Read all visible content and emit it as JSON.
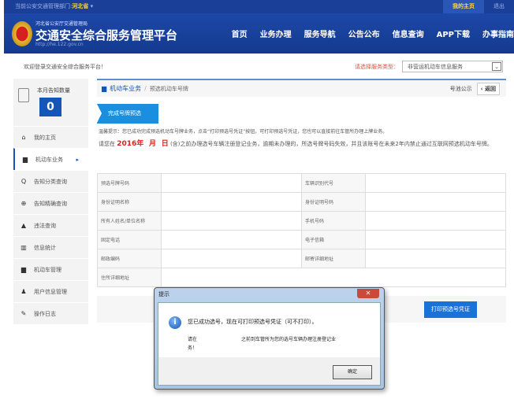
{
  "topbar": {
    "dept_label": "当前公安交通管理部门:",
    "dept": "河北省",
    "home": "我的主页",
    "logout": "退出"
  },
  "header": {
    "sub": "河北省公安厅交通管理局",
    "title": "交通安全综合服务管理平台",
    "url": "http://he.122.gov.cn",
    "nav": [
      "首页",
      "业务办理",
      "服务导航",
      "公告公布",
      "信息查询",
      "APP下载",
      "办事指南"
    ]
  },
  "welcome": "欢迎登录交通安全综合服务平台！",
  "service": {
    "label": "请选择服务类型：",
    "value": "非营运机动车信息服务"
  },
  "sidebar": {
    "count_label": "本月告知数量",
    "count": "0",
    "items": [
      {
        "icon": "home-icon",
        "glyph": "⌂",
        "label": "我的主页"
      },
      {
        "icon": "truck-icon",
        "glyph": "▆",
        "label": "机动车业务"
      },
      {
        "icon": "search-icon",
        "glyph": "Q",
        "label": "告知分类查询"
      },
      {
        "icon": "zoom-icon",
        "glyph": "⊕",
        "label": "告知精确查询"
      },
      {
        "icon": "warning-icon",
        "glyph": "▲",
        "label": "违法查询"
      },
      {
        "icon": "chart-icon",
        "glyph": "▥",
        "label": "信息统计"
      },
      {
        "icon": "car-icon",
        "glyph": "▆",
        "label": "机动车管理"
      },
      {
        "icon": "user-icon",
        "glyph": "♟",
        "label": "用户信息管理"
      },
      {
        "icon": "log-icon",
        "glyph": "✎",
        "label": "操作日志"
      }
    ]
  },
  "breadcrumb": {
    "section": "机动车业务",
    "page": "预选机动车号牌",
    "pool": "号池公示",
    "back": "‹ 返回"
  },
  "step": "完成号牌预选",
  "tip": "温馨提示：您已成功完成预选机动车号牌业务，点击“打印预选号凭证”按钮，可打印预选号凭证，您也可以直接前往车管所办理上牌业务。",
  "warn": {
    "pre": "请您在",
    "year": "2016年",
    "month": "月",
    "day": "日",
    "post": "(含)之前办理选号车辆注册登记业务，逾期未办理的，所选号牌号码失效，并且该账号在未来2年内禁止通过互联网预选机动车号牌。"
  },
  "table": [
    [
      "预选号牌号码",
      "",
      "车辆识别代号",
      ""
    ],
    [
      "身份证明名称",
      "",
      "身份证明号码",
      ""
    ],
    [
      "所有人姓名/单位名称",
      "",
      "手机号码",
      ""
    ],
    [
      "固定电话",
      "",
      "电子信箱",
      ""
    ],
    [
      "邮政编码",
      "",
      "邮寄详细地址",
      ""
    ]
  ],
  "address_label": "住所详细地址",
  "print": "打印预选号凭证",
  "dialog": {
    "title": "提示",
    "close": "✕",
    "msg1": "您已成功选号，现在可打印预选号凭证（可不打印）。",
    "msg2a": "请在",
    "msg2b": "之前到车管所为您的选号车辆办理注册登记业",
    "msg3": "务！",
    "ok": "确定"
  }
}
